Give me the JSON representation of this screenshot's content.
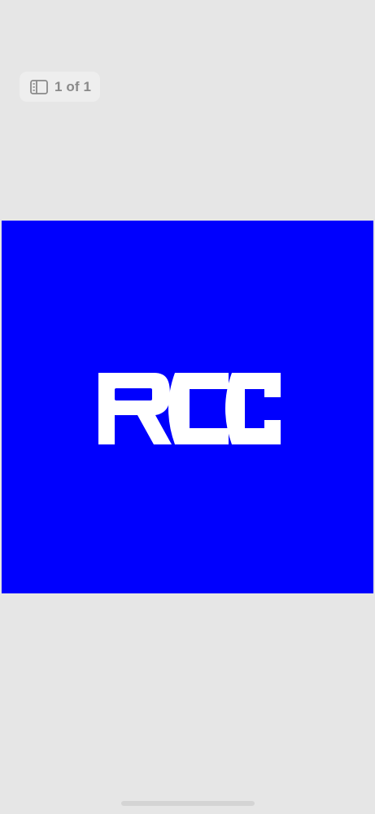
{
  "viewer": {
    "page_indicator": {
      "icon": "page-thumbnails-icon",
      "label": "1 of 1"
    }
  },
  "image": {
    "background_color": "#0000FE",
    "logo_color": "#FFFFFF"
  }
}
